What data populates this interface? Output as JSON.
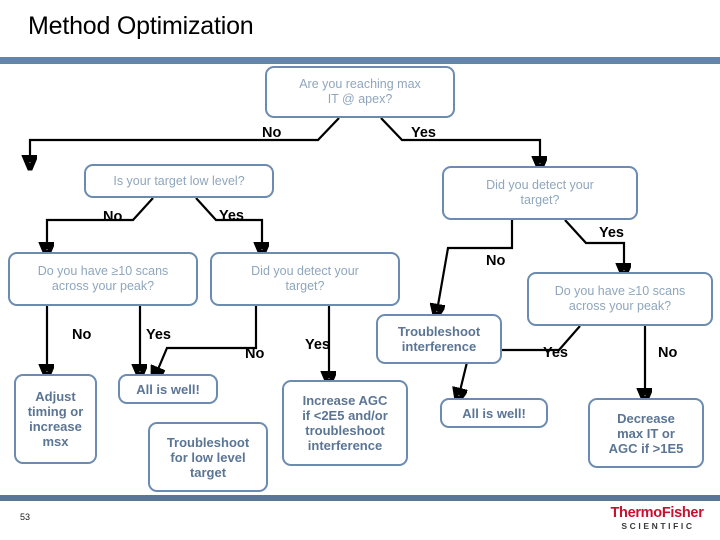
{
  "slide": {
    "title": "Method Optimization",
    "page_number": "53",
    "accent_color": "#6485ab",
    "box_border_color": "#6b8cb0",
    "decision_text_color": "#8fa6bd",
    "action_text_color": "#5b7594"
  },
  "logo": {
    "main": "ThermoFisher",
    "sub": "SCIENTIFIC",
    "main_color": "#c8102e"
  },
  "flowchart": {
    "type": "decision-tree",
    "nodes": {
      "root": "Are you reaching max\nIT @ apex?",
      "left_q1": "Is your target low level?",
      "left_q2": "Do you have ≥10 scans\nacross your peak?",
      "left_q3": "Did you detect your\ntarget?",
      "left_a1": "Adjust\ntiming or\nincrease\nmsx",
      "left_a2": "All is well!",
      "left_a3": "Troubleshoot\nfor low level\ntarget",
      "left_a4": "Increase AGC\nif <2E5 and/or\ntroubleshoot\ninterference",
      "right_q1": "Did you detect your\ntarget?",
      "right_q2": "Do you have ≥10 scans\nacross your peak?",
      "right_a1": "Troubleshoot\ninterference",
      "right_a2": "All is well!",
      "right_a3": "Decrease\nmax IT or\nAGC if >1E5"
    },
    "edge_labels": {
      "root_no": "No",
      "root_yes": "Yes",
      "left_q1_no": "No",
      "left_q1_yes": "Yes",
      "left_q2_no": "No",
      "left_q2_yes": "Yes",
      "left_q3_no": "No",
      "left_q3_yes": "Yes",
      "right_q1_no": "No",
      "right_q1_yes": "Yes",
      "right_q2_yes": "Yes",
      "right_q2_no": "No"
    }
  }
}
